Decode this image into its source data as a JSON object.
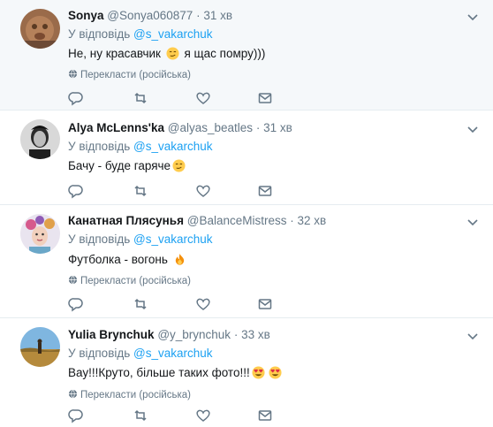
{
  "reply_prefix": "У відповідь",
  "mention": "@s_vakarchuk",
  "translate_label": "Перекласти (російська)",
  "colors": {
    "accent": "#1da1f2",
    "secondary": "#657786",
    "highlight_bg": "#f5f8fa"
  },
  "tweets": [
    {
      "name": "Sonya",
      "handle": "@Sonya060877",
      "dot": "·",
      "time": "31 хв",
      "text_a": "Не,   ну красавчик ",
      "text_b": " я щас помру)))",
      "emoji": [
        "smirk-face"
      ],
      "has_translate": true
    },
    {
      "name": "Alya McLenns'ka",
      "handle": "@alyas_beatles",
      "dot": "·",
      "time": "31 хв",
      "text_a": "Бачу - буде гаряче",
      "text_b": "",
      "emoji": [
        "smirk-face"
      ],
      "has_translate": false
    },
    {
      "name": "Канатная Плясунья",
      "handle": "@BalanceMistress",
      "dot": "·",
      "time": "32 хв",
      "text_a": "Футболка - вогонь ",
      "text_b": "",
      "emoji": [
        "fire"
      ],
      "has_translate": true
    },
    {
      "name": "Yulia Brynchuk",
      "handle": "@y_brynchuk",
      "dot": "·",
      "time": "33 хв",
      "text_a": "Вау!!!Круто, більше таких фото!!!",
      "text_b": "",
      "emoji": [
        "heart-eyes",
        "heart-eyes"
      ],
      "has_translate": true
    }
  ]
}
